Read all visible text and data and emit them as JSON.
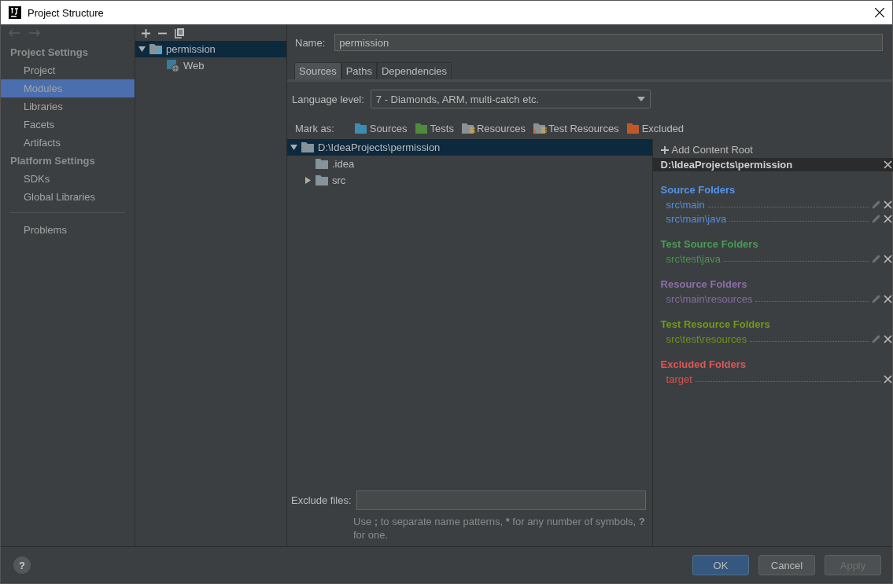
{
  "window": {
    "title": "Project Structure"
  },
  "sidebar": {
    "sections": [
      {
        "title": "Project Settings",
        "items": [
          {
            "label": "Project",
            "selected": false
          },
          {
            "label": "Modules",
            "selected": true
          },
          {
            "label": "Libraries",
            "selected": false
          },
          {
            "label": "Facets",
            "selected": false
          },
          {
            "label": "Artifacts",
            "selected": false
          }
        ]
      },
      {
        "title": "Platform Settings",
        "items": [
          {
            "label": "SDKs",
            "selected": false
          },
          {
            "label": "Global Libraries",
            "selected": false
          }
        ]
      }
    ],
    "footer_items": [
      {
        "label": "Problems",
        "selected": false
      }
    ]
  },
  "module_tree": {
    "items": [
      {
        "label": "permission",
        "kind": "module",
        "selected": true,
        "expanded": true,
        "children": [
          {
            "label": "Web",
            "kind": "facet",
            "selected": false
          }
        ]
      }
    ]
  },
  "name_field": {
    "label": "Name:",
    "value": "permission"
  },
  "tabs": [
    {
      "label": "Sources",
      "selected": true
    },
    {
      "label": "Paths",
      "selected": false
    },
    {
      "label": "Dependencies",
      "selected": false
    }
  ],
  "language_level": {
    "label": "Language level:",
    "value": "7 - Diamonds, ARM, multi-catch etc."
  },
  "mark_as": {
    "label": "Mark as:",
    "options": [
      {
        "label": "Sources",
        "kind": "sources"
      },
      {
        "label": "Tests",
        "kind": "tests"
      },
      {
        "label": "Resources",
        "kind": "resources"
      },
      {
        "label": "Test Resources",
        "kind": "test_resources"
      },
      {
        "label": "Excluded",
        "kind": "excluded"
      }
    ]
  },
  "content_tree": [
    {
      "label": "D:\\IdeaProjects\\permission",
      "selected": true,
      "expanded": true,
      "children": [
        {
          "label": ".idea",
          "selected": false
        },
        {
          "label": "src",
          "selected": false,
          "expanded": false
        }
      ]
    }
  ],
  "content_roots": {
    "add_label": "Add Content Root",
    "root": "D:\\IdeaProjects\\permission",
    "groups": [
      {
        "title": "Source Folders",
        "color": "#5394ec",
        "items": [
          {
            "path": "src\\main",
            "editable": true
          },
          {
            "path": "src\\main\\java",
            "editable": true
          }
        ]
      },
      {
        "title": "Test Source Folders",
        "color": "#499c54",
        "items": [
          {
            "path": "src\\test\\java",
            "editable": true
          }
        ]
      },
      {
        "title": "Resource Folders",
        "color": "#8a6fa6",
        "items": [
          {
            "path": "src\\main\\resources",
            "editable": true
          }
        ]
      },
      {
        "title": "Test Resource Folders",
        "color": "#6f9a1c",
        "items": [
          {
            "path": "src\\test\\resources",
            "editable": true
          }
        ]
      },
      {
        "title": "Excluded Folders",
        "color": "#e05555",
        "items": [
          {
            "path": "target",
            "editable": false
          }
        ]
      }
    ]
  },
  "exclude_files": {
    "label": "Exclude files:",
    "hint": [
      {
        "text": "Use ",
        "bold": false
      },
      {
        "text": ";",
        "bold": true
      },
      {
        "text": " to separate name patterns, ",
        "bold": false
      },
      {
        "text": "*",
        "bold": true
      },
      {
        "text": " for any number of symbols, ",
        "bold": false
      },
      {
        "text": "?",
        "bold": true
      },
      {
        "text": " for one.",
        "bold": false
      }
    ]
  },
  "help": {
    "label": "?"
  },
  "buttons": [
    {
      "label": "OK",
      "kind": "primary",
      "disabled": false
    },
    {
      "label": "Cancel",
      "kind": "normal",
      "disabled": false
    },
    {
      "label": "Apply",
      "kind": "normal",
      "disabled": true
    }
  ]
}
